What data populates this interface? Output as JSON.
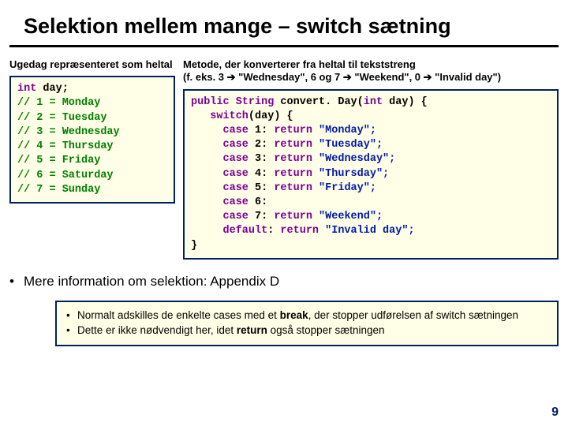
{
  "title": "Selektion mellem mange – switch sætning",
  "left": {
    "subhead": "Ugedag repræsenteret som heltal",
    "code": {
      "decl_kw": "int",
      "decl_rest": " day;",
      "comments": [
        "// 1 = Monday",
        "// 2 = Tuesday",
        "// 3 = Wednesday",
        "// 4 = Thursday",
        "// 5 = Friday",
        "// 6 = Saturday",
        "// 7 = Sunday"
      ]
    }
  },
  "right": {
    "subhead_a": "Metode, der konverterer fra heltal til tekststreng",
    "subhead_b1": "(f. eks. 3 ",
    "subhead_arrow": "➔",
    "subhead_b2": " \"Wednesday\", 6 og 7 ",
    "subhead_b3": " \"Weekend\", 0 ",
    "subhead_b4": " \"Invalid day\")",
    "code": {
      "l1a": "public",
      "l1b": " String",
      "l1c": " convert. Day(",
      "l1d": "int",
      "l1e": " day) {",
      "l2a": "   switch",
      "l2b": "(day) {",
      "c1a": "     case",
      "c1b": " 1: ",
      "c1c": "return",
      "c1d": " \"Monday\";",
      "c2a": "     case",
      "c2b": " 2: ",
      "c2c": "return",
      "c2d": " \"Tuesday\";",
      "c3a": "     case",
      "c3b": " 3: ",
      "c3c": "return",
      "c3d": " \"Wednesday\";",
      "c4a": "     case",
      "c4b": " 4: ",
      "c4c": "return",
      "c4d": " \"Thursday\";",
      "c5a": "     case",
      "c5b": " 5: ",
      "c5c": "return",
      "c5d": " \"Friday\";",
      "c6a": "     case",
      "c6b": " 6:",
      "c7a": "     case",
      "c7b": " 7: ",
      "c7c": "return",
      "c7d": " \"Weekend\";",
      "d1a": "     default",
      "d1b": ": ",
      "d1c": "return",
      "d1d": " \"Invalid day\";",
      "l_end": "}"
    }
  },
  "bullet": "Mere information om selektion: Appendix D",
  "notes": {
    "n1a": "Normalt adskilles de enkelte cases med et ",
    "n1_kw": "break",
    "n1b": ", der stopper udførelsen af switch sætningen",
    "n2a": "Dette er ikke nødvendigt her, idet ",
    "n2_kw": "return",
    "n2b": " også stopper sætningen"
  },
  "page": "9"
}
